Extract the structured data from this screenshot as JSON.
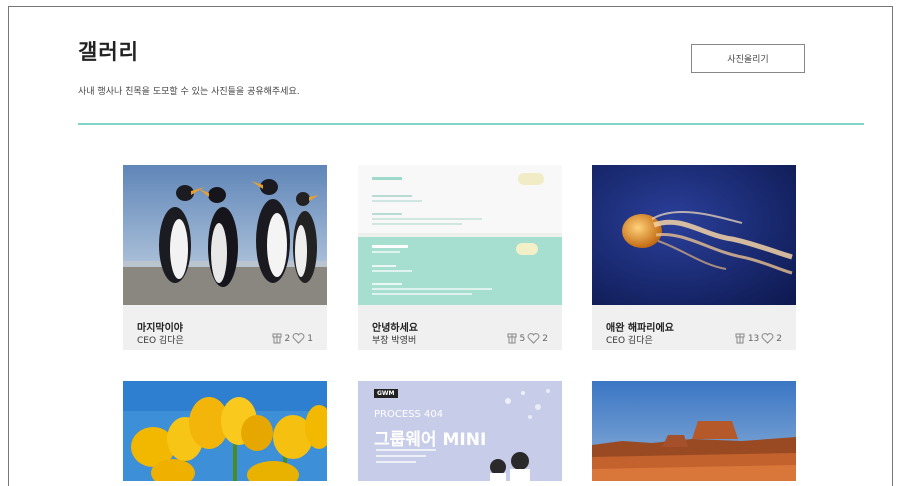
{
  "page": {
    "title": "갤러리",
    "subtitle": "사내 행사나 친목을 도모할 수 있는 사진들을 공유해주세요.",
    "upload_label": "사진올리기"
  },
  "cards": [
    {
      "title": "마지막이야",
      "author": "CEO 김다은",
      "views": "2",
      "likes": "1"
    },
    {
      "title": "안녕하세요",
      "author": "부장 박영버",
      "views": "5",
      "likes": "2"
    },
    {
      "title": "애완 해파리에요",
      "author": "CEO 김다은",
      "views": "13",
      "likes": "2"
    }
  ],
  "poster": {
    "badge": "GWM",
    "line1": "PROCESS 404",
    "line2": "그룹웨어 MINI"
  },
  "colors": {
    "accent": "#7fd6c8",
    "card_bg": "#f0f0f0"
  }
}
